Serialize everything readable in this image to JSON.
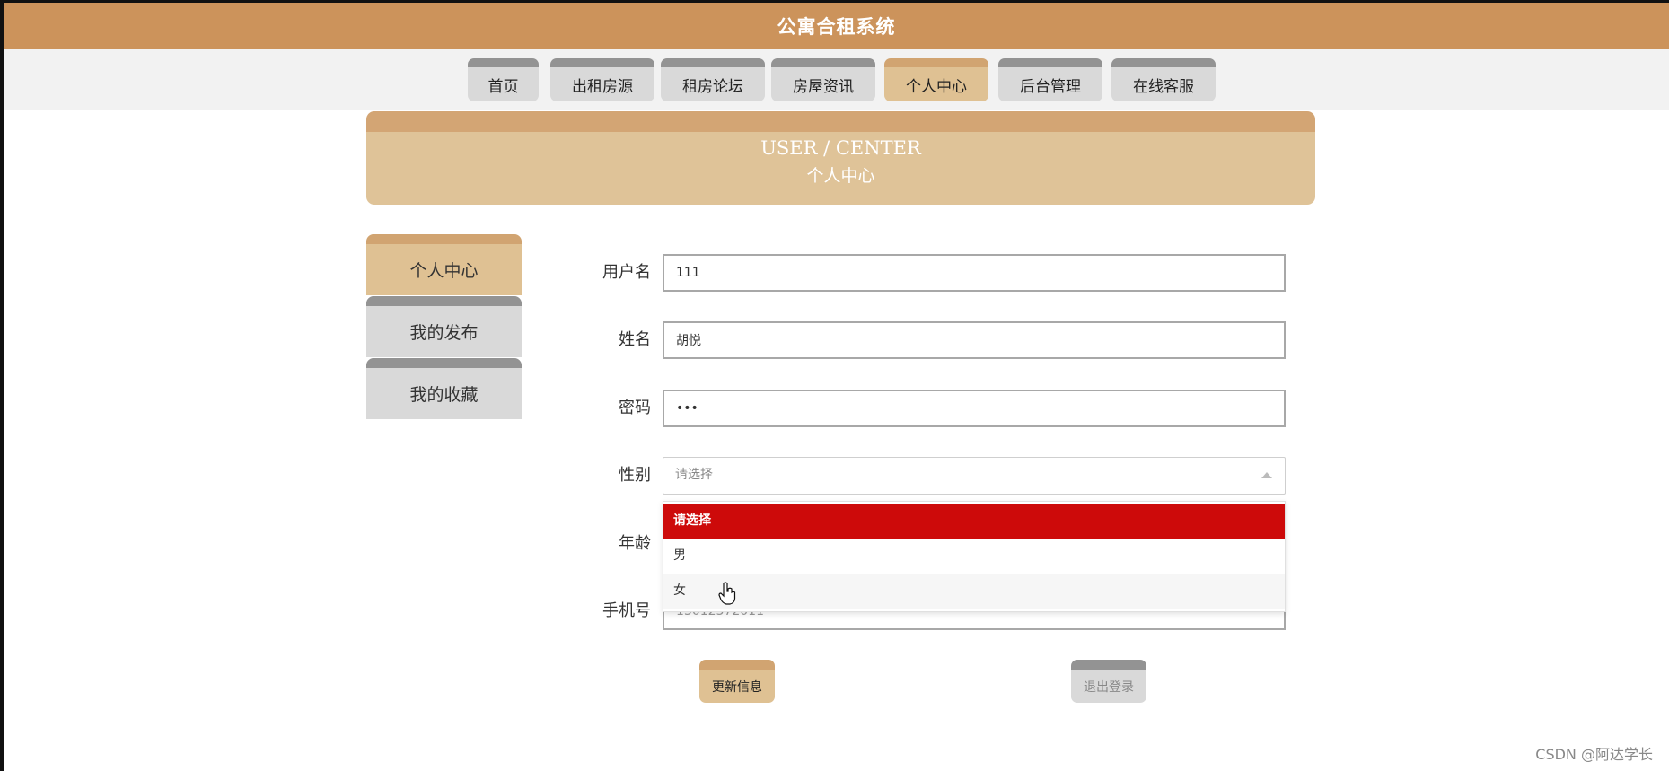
{
  "header": {
    "title": "公寓合租系统"
  },
  "nav": {
    "tabs": [
      "首页",
      "出租房源",
      "租房论坛",
      "房屋资讯",
      "个人中心",
      "后台管理",
      "在线客服"
    ],
    "active_index": 4
  },
  "banner": {
    "en": "USER / CENTER",
    "zh": "个人中心"
  },
  "sidebar": {
    "items": [
      "个人中心",
      "我的发布",
      "我的收藏"
    ],
    "active_index": 0
  },
  "form": {
    "username_label": "用户名",
    "username_value": "111",
    "name_label": "姓名",
    "name_value": "胡悦",
    "password_label": "密码",
    "password_value": "•••",
    "gender_label": "性别",
    "gender_placeholder": "请选择",
    "age_label": "年龄",
    "phone_label": "手机号",
    "phone_value": "13012372011"
  },
  "gender_dropdown": {
    "options": [
      "请选择",
      "男",
      "女"
    ],
    "selected_index": 0
  },
  "buttons": {
    "update": "更新信息",
    "logout": "退出登录"
  },
  "watermark": "CSDN @阿达学长",
  "colors": {
    "header": "#cc935b",
    "accent_tab": "#dfc193",
    "tab_gray": "#d9d9d9",
    "dropdown_selected": "#cd0a0a"
  }
}
